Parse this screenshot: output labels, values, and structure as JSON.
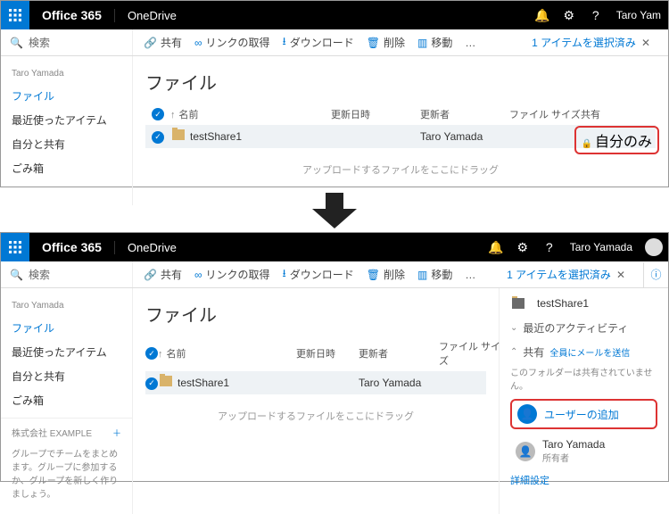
{
  "topbar": {
    "brand": "Office 365",
    "app": "OneDrive",
    "user": "Taro Yam",
    "user2": "Taro Yamada"
  },
  "search": {
    "placeholder": "検索"
  },
  "cmds": {
    "share": "共有",
    "link": "リンクの取得",
    "download": "ダウンロード",
    "delete": "削除",
    "move": "移動",
    "more": "…"
  },
  "selection": {
    "text": "1 アイテムを選択済み"
  },
  "nav": {
    "owner": "Taro Yamada",
    "files": "ファイル",
    "recent": "最近使ったアイテム",
    "shared": "自分と共有",
    "recycle": "ごみ箱",
    "company_label": "株式会社",
    "company": "EXAMPLE",
    "group_msg": "グループでチームをまとめます。グループに参加するか、グループを新しく作りましょう。"
  },
  "page": {
    "title": "ファイル"
  },
  "cols": {
    "name": "名前",
    "date": "更新日時",
    "user": "更新者",
    "size": "ファイル サイズ",
    "share": "共有"
  },
  "files": [
    {
      "name": "testShare1",
      "user": "Taro Yamada",
      "share": "自分のみ"
    }
  ],
  "drop": "アップロードするファイルをここにドラッグ",
  "details": {
    "filename": "testShare1",
    "activity": "最近のアクティビティ",
    "share_title": "共有",
    "mail_all": "全員にメールを送信",
    "not_shared": "このフォルダーは共有されていません。",
    "add_user": "ユーザーの追加",
    "owner": "Taro Yamada",
    "owner_role": "所有者",
    "advanced": "詳細設定"
  }
}
